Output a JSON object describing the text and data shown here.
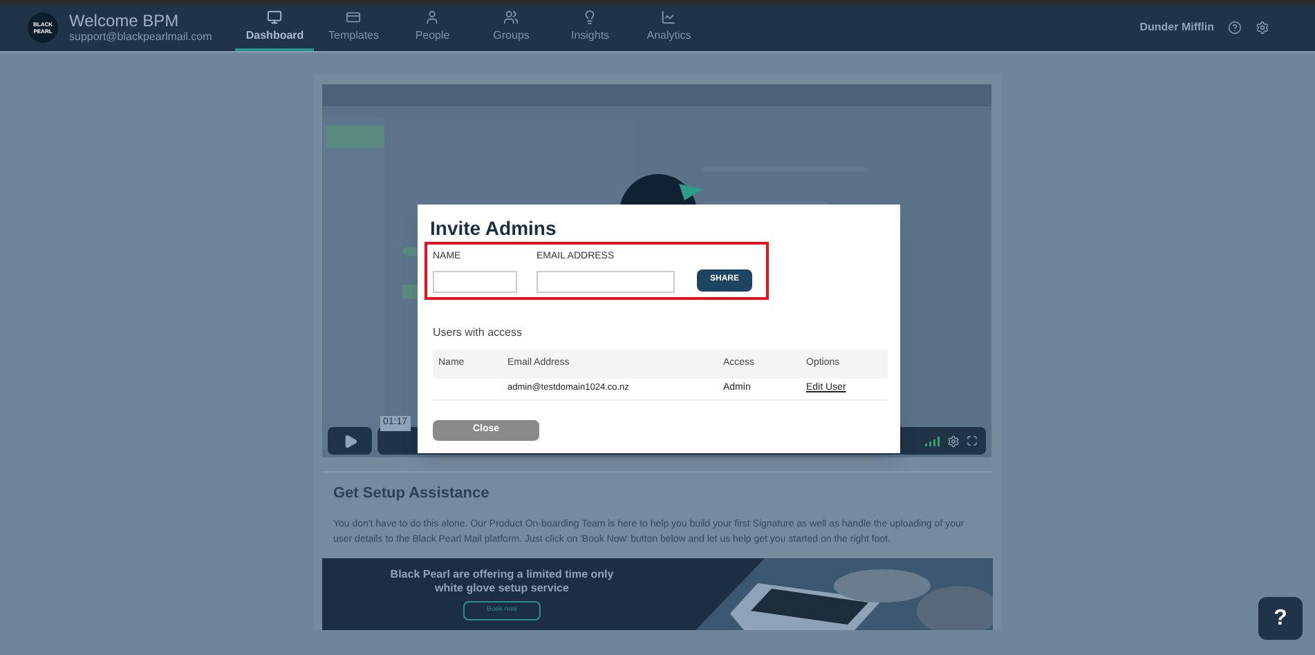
{
  "nav": {
    "logo_text": "BLACK PEARL",
    "title": "Welcome BPM",
    "email": "support@blackpearlmail.com",
    "tabs": [
      {
        "label": "Dashboard",
        "kind": "monitor",
        "selected": true
      },
      {
        "label": "Templates",
        "kind": "template",
        "selected": false
      },
      {
        "label": "People",
        "kind": "person",
        "selected": false
      },
      {
        "label": "Groups",
        "kind": "group",
        "selected": false
      },
      {
        "label": "Insights",
        "kind": "bulb",
        "selected": false
      },
      {
        "label": "Analytics",
        "kind": "chart",
        "selected": false
      }
    ],
    "account": "Dunder Mifflin"
  },
  "video": {
    "time": "01:17"
  },
  "dialog": {
    "title": "Invite Admins",
    "highlighted": true,
    "fields": [
      {
        "label": "NAME"
      },
      {
        "label": "EMAIL ADDRESS"
      }
    ],
    "share_button": "SHARE",
    "users_heading": "Users with access",
    "columns": [
      "Name",
      "Email Address",
      "Access",
      "Options"
    ],
    "rows": [
      {
        "email": "admin@testdomain1024.co.nz",
        "access": "Admin",
        "option": "Edit User"
      }
    ],
    "close_button": "Close"
  },
  "setup": {
    "heading": "Get Setup Assistance",
    "text": "You don't have to do this alone. Our Product On-boarding Team is here to help you build your first Signature as well as handle the uploading of your user details to the Black Pearl Mail platform. Just click on 'Book Now' button below and let us help get you started on the right foot.",
    "banner": {
      "line1": "Black Pearl are offering a limited time only",
      "line2": "white glove setup service",
      "button": "Book now"
    }
  },
  "help_button": "?"
}
